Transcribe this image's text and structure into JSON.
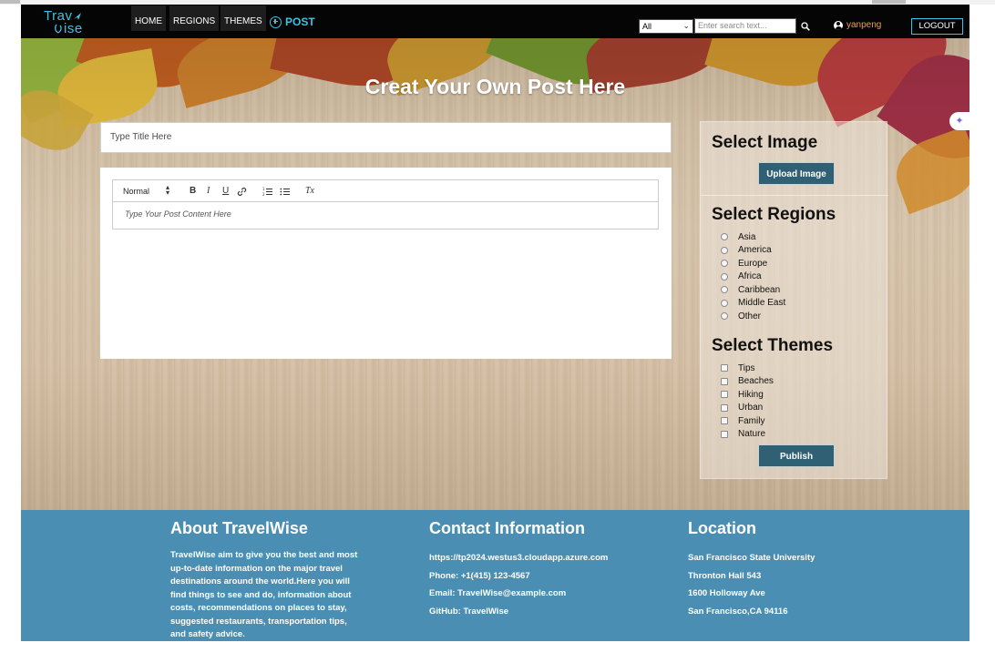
{
  "navbar": {
    "logo_line1": "Trav",
    "logo_line2": "ise",
    "links": {
      "home": "HOME",
      "regions": "REGIONS",
      "themes": "THEMES",
      "post": "POST"
    },
    "filter_selected": "All",
    "search_placeholder": "Enter search text...",
    "username": "yanpeng",
    "logout_label": "LOGOUT"
  },
  "hero": {
    "title": "Creat Your Own Post Here",
    "ai_badge": "✦"
  },
  "editor": {
    "title_placeholder": "Type Title Here",
    "format_selected": "Normal",
    "toolbar": {
      "bold": "B",
      "italic": "I",
      "underline": "U",
      "clear": "Tx"
    },
    "content_placeholder": "Type Your Post Content Here"
  },
  "panel": {
    "image_heading": "Select Image",
    "upload_label": "Upload Image",
    "regions_heading": "Select Regions",
    "regions": [
      "Asia",
      "America",
      "Europe",
      "Africa",
      "Caribbean",
      "Middle East",
      "Other"
    ],
    "themes_heading": "Select Themes",
    "themes": [
      "Tips",
      "Beaches",
      "Hiking",
      "Urban",
      "Family",
      "Nature"
    ],
    "publish_label": "Publish"
  },
  "footer": {
    "about": {
      "heading": "About TravelWise",
      "text": "TravelWise aim to give you the best and most up-to-date information on the major travel destinations around the world.Here you will find things to see and do, information about costs, recommendations on places to stay, suggested restaurants, transportation tips, and safety advice."
    },
    "contact": {
      "heading": "Contact Information",
      "lines": [
        "https://tp2024.westus3.cloudapp.azure.com",
        "Phone: +1(415) 123-4567",
        "Email: TravelWise@example.com",
        "GitHub: TravelWise"
      ]
    },
    "location": {
      "heading": "Location",
      "lines": [
        "San Francisco State University",
        "Thronton Hall 543",
        "1600 Holloway Ave",
        "San Francisco,CA 94116"
      ]
    }
  },
  "colors": {
    "navbar_bg": "#050505",
    "accent_cyan": "#3ec1e4",
    "username_orange": "#e8a33b",
    "button_teal": "#2f6073",
    "footer_blue": "#4a8fb3"
  },
  "icons": [
    "plus-circle-icon",
    "search-icon",
    "user-icon",
    "chevron-down-icon",
    "sparkle-icon",
    "bold-icon",
    "italic-icon",
    "underline-icon",
    "link-icon",
    "ordered-list-icon",
    "bullet-list-icon",
    "clear-format-icon"
  ]
}
